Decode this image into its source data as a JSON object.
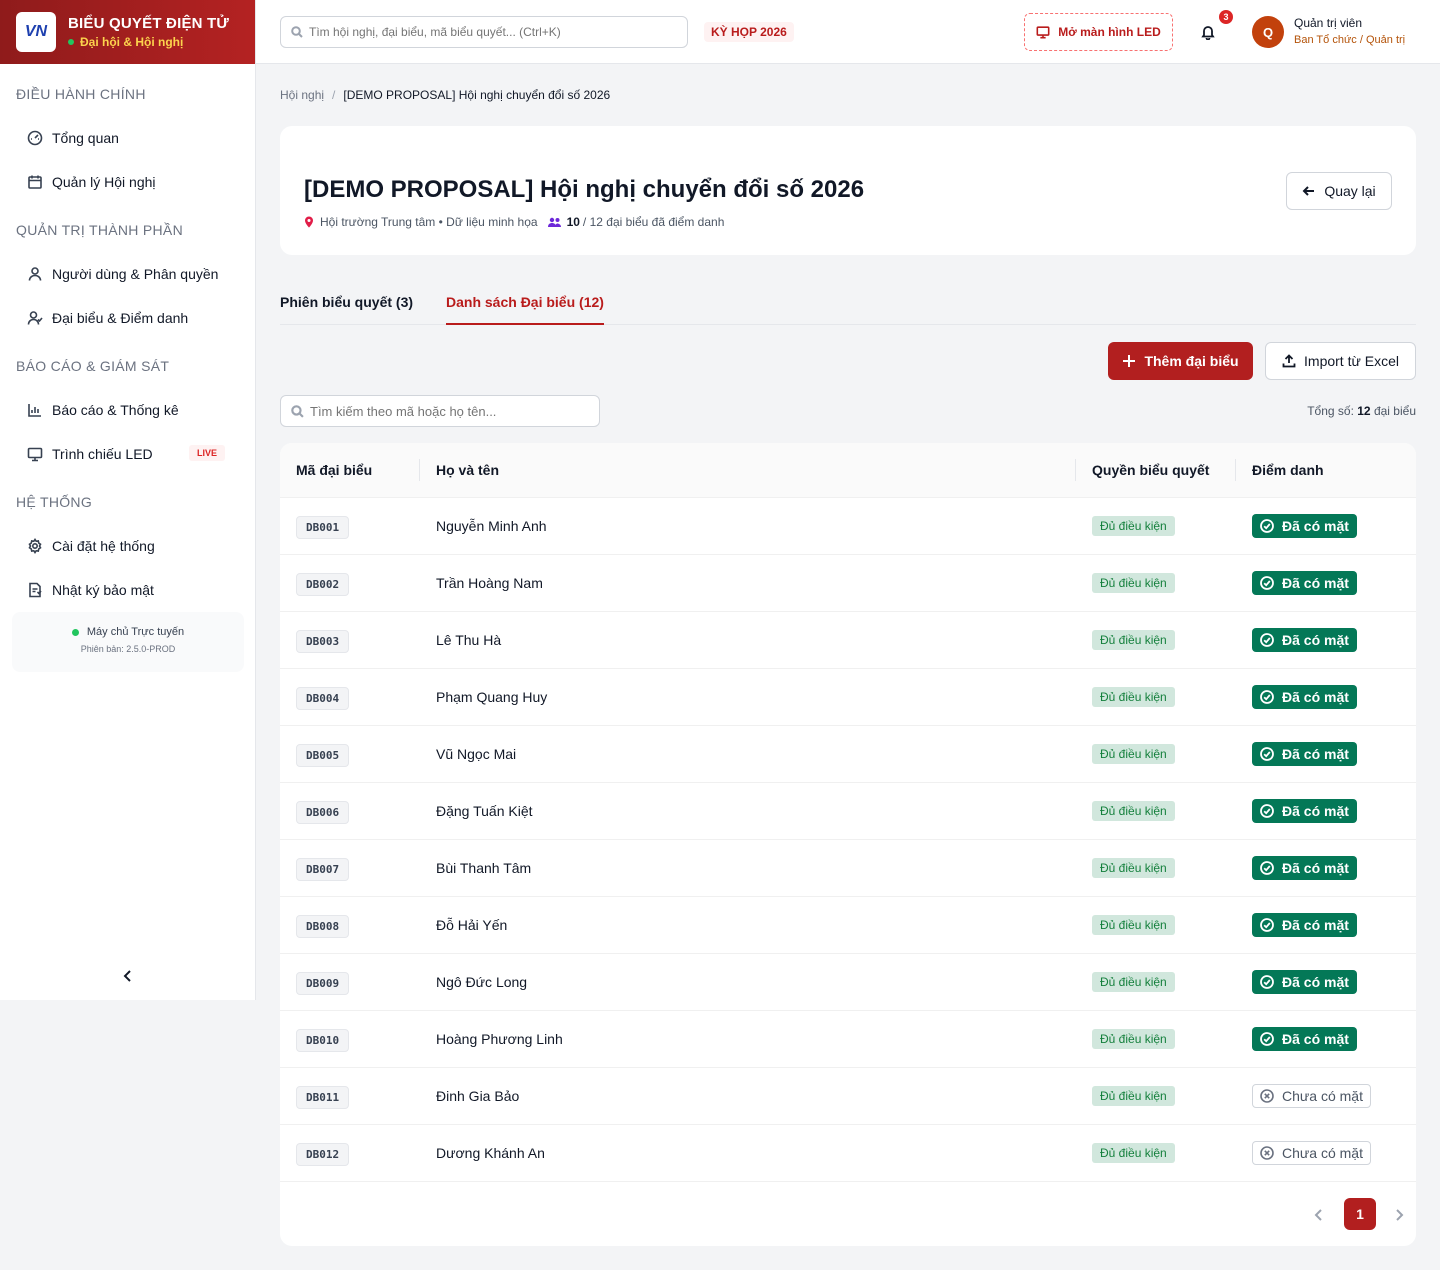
{
  "brand": {
    "logo_text": "VN",
    "title": "BIỂU QUYẾT ĐIỆN TỬ",
    "subtitle": "Đại hội & Hội nghị"
  },
  "sidebar": {
    "sections": [
      {
        "label": "ĐIỀU HÀNH CHÍNH",
        "items": [
          {
            "label": "Tổng quan",
            "icon": "dashboard-icon"
          },
          {
            "label": "Quản lý Hội nghị",
            "icon": "calendar-icon"
          }
        ]
      },
      {
        "label": "QUẢN TRỊ THÀNH PHẦN",
        "items": [
          {
            "label": "Người dùng & Phân quyền",
            "icon": "user-icon"
          },
          {
            "label": "Đại biểu & Điểm danh",
            "icon": "users-icon"
          }
        ]
      },
      {
        "label": "BÁO CÁO & GIÁM SÁT",
        "items": [
          {
            "label": "Báo cáo & Thống kê",
            "icon": "bar-chart-icon"
          },
          {
            "label": "Trình chiếu LED",
            "icon": "monitor-icon",
            "badge": "LIVE"
          }
        ]
      },
      {
        "label": "HỆ THỐNG",
        "items": [
          {
            "label": "Cài đặt hệ thống",
            "icon": "gear-icon"
          },
          {
            "label": "Nhật ký bảo mật",
            "icon": "file-shield-icon"
          }
        ]
      }
    ],
    "server_status": "Máy chủ Trực tuyến",
    "version": "Phiên bản: 2.5.0-PROD"
  },
  "header": {
    "search_placeholder": "Tìm hội nghị, đại biểu, mã biểu quyết... (Ctrl+K)",
    "session_tag": "KỲ HỌP 2026",
    "led_button": "Mở màn hình LED",
    "notification_count": "3",
    "avatar_letter": "Q",
    "user_name": "Quản trị viên",
    "user_role": "Ban Tổ chức / Quản trị"
  },
  "breadcrumb": {
    "root": "Hội nghị",
    "separator": "/",
    "current": "[DEMO PROPOSAL] Hội nghị chuyển đổi số 2026"
  },
  "conference": {
    "title": "[DEMO PROPOSAL] Hội nghị chuyển đổi số 2026",
    "location": "Hội trường Trung tâm • Dữ liệu minh họa",
    "attended": "10",
    "attendance_rest": "/ 12 đại biểu đã điểm danh",
    "back_label": "Quay lại"
  },
  "tabs": [
    {
      "label": "Phiên biểu quyết (3)",
      "active": false
    },
    {
      "label": "Danh sách Đại biểu (12)",
      "active": true
    }
  ],
  "actions": {
    "add_label": "Thêm đại biểu",
    "import_label": "Import từ Excel"
  },
  "list": {
    "search_placeholder": "Tìm kiếm theo mã hoặc họ tên...",
    "total_label": "Tổng số:",
    "total_count": "12",
    "total_unit": "đại biểu",
    "columns": [
      "Mã đại biểu",
      "Họ và tên",
      "Quyền biểu quyết",
      "Điểm danh"
    ],
    "rows": [
      {
        "code": "DB001",
        "name": "Nguyễn Minh Anh",
        "eligibility": "Đủ điều kiện",
        "status": "Đã có mặt",
        "present": true
      },
      {
        "code": "DB002",
        "name": "Trần Hoàng Nam",
        "eligibility": "Đủ điều kiện",
        "status": "Đã có mặt",
        "present": true
      },
      {
        "code": "DB003",
        "name": "Lê Thu Hà",
        "eligibility": "Đủ điều kiện",
        "status": "Đã có mặt",
        "present": true
      },
      {
        "code": "DB004",
        "name": "Phạm Quang Huy",
        "eligibility": "Đủ điều kiện",
        "status": "Đã có mặt",
        "present": true
      },
      {
        "code": "DB005",
        "name": "Vũ Ngọc Mai",
        "eligibility": "Đủ điều kiện",
        "status": "Đã có mặt",
        "present": true
      },
      {
        "code": "DB006",
        "name": "Đặng Tuấn Kiệt",
        "eligibility": "Đủ điều kiện",
        "status": "Đã có mặt",
        "present": true
      },
      {
        "code": "DB007",
        "name": "Bùi Thanh Tâm",
        "eligibility": "Đủ điều kiện",
        "status": "Đã có mặt",
        "present": true
      },
      {
        "code": "DB008",
        "name": "Đỗ Hải Yến",
        "eligibility": "Đủ điều kiện",
        "status": "Đã có mặt",
        "present": true
      },
      {
        "code": "DB009",
        "name": "Ngô Đức Long",
        "eligibility": "Đủ điều kiện",
        "status": "Đã có mặt",
        "present": true
      },
      {
        "code": "DB010",
        "name": "Hoàng Phương Linh",
        "eligibility": "Đủ điều kiện",
        "status": "Đã có mặt",
        "present": true
      },
      {
        "code": "DB011",
        "name": "Đinh Gia Bảo",
        "eligibility": "Đủ điều kiện",
        "status": "Chưa có mặt",
        "present": false
      },
      {
        "code": "DB012",
        "name": "Dương Khánh An",
        "eligibility": "Đủ điều kiện",
        "status": "Chưa có mặt",
        "present": false
      }
    ],
    "current_page": "1"
  },
  "colors": {
    "brand_red": "#b21f1f",
    "present_green": "#047857",
    "eligible_bg": "#d1e7dd"
  }
}
